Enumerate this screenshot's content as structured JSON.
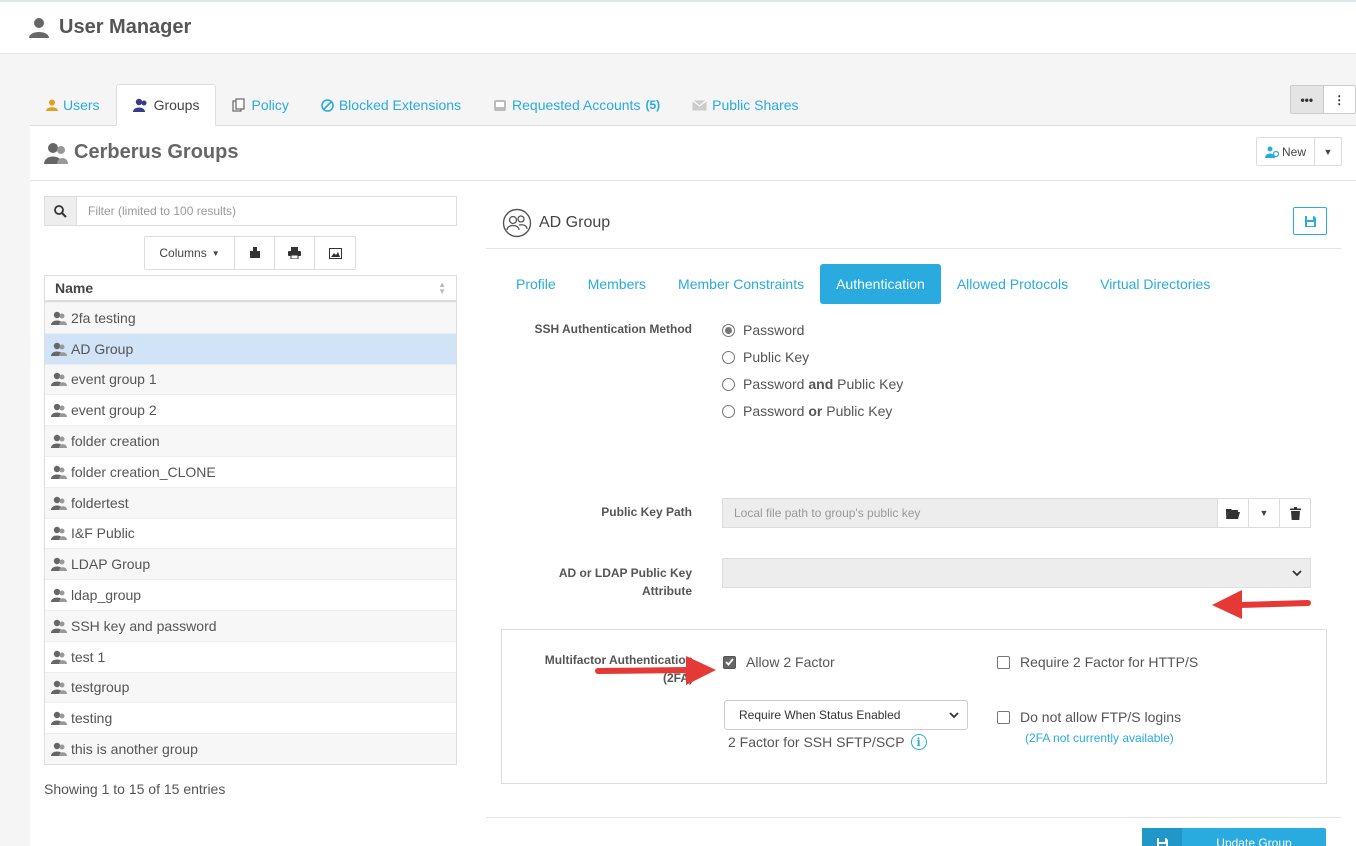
{
  "app": {
    "title": "User Manager"
  },
  "tabs": [
    {
      "label": "Users",
      "icon": "user-icon"
    },
    {
      "label": "Groups",
      "icon": "group-icon",
      "active": true
    },
    {
      "label": "Policy",
      "icon": "policy-icon"
    },
    {
      "label": "Blocked Extensions",
      "icon": "block-icon"
    },
    {
      "label": "Requested  Accounts",
      "count": "(5)",
      "icon": "inbox-icon"
    },
    {
      "label": "Public Shares",
      "icon": "envelope-icon"
    }
  ],
  "page": {
    "title": "Cerberus Groups",
    "new_label": "New"
  },
  "filter": {
    "placeholder": "Filter (limited to 100 results)"
  },
  "toolbar": {
    "columns_label": "Columns"
  },
  "table": {
    "header": "Name",
    "rows": [
      "2fa testing",
      "AD Group",
      "event group 1",
      "event group 2",
      "folder creation",
      "folder creation_CLONE",
      "foldertest",
      "I&F Public",
      "LDAP Group",
      "ldap_group",
      "SSH key and password",
      "test 1",
      "testgroup",
      "testing",
      "this is another group"
    ],
    "selected_index": 1,
    "showing": "Showing 1 to 15 of 15 entries"
  },
  "detail": {
    "title": "AD Group",
    "subtabs": [
      "Profile",
      "Members",
      "Member Constraints",
      "Authentication",
      "Allowed Protocols",
      "Virtual Directories"
    ],
    "active_subtab": "Authentication",
    "ssh_label": "SSH Authentication Method",
    "ssh_options": {
      "password": "Password",
      "public_key": "Public Key",
      "pw_and_a": "Password ",
      "pw_and_b": "and",
      "pw_and_c": " Public Key",
      "pw_or_a": "Password ",
      "pw_or_b": "or",
      "pw_or_c": " Public Key"
    },
    "pk_label": "Public Key Path",
    "pk_placeholder": "Local file path to group's public key",
    "ldap_label_1": "AD or LDAP Public Key",
    "ldap_label_2": "Attribute",
    "mfa_label_1": "Multifactor Authentication",
    "mfa_label_2": "(2FA)",
    "allow_2fa": "Allow 2 Factor",
    "require_https": "Require 2 Factor for HTTP/S",
    "require_select": "Require When Status Enabled",
    "ssh_2fa_label": "2 Factor for SSH SFTP/SCP",
    "no_ftp": "Do not allow FTP/S logins",
    "note_2fa": "(2FA not currently available)",
    "update_label": "Update Group"
  },
  "colors": {
    "accent": "#29abe0",
    "arrow": "#e53935",
    "selected_row": "#d0e3f7"
  }
}
